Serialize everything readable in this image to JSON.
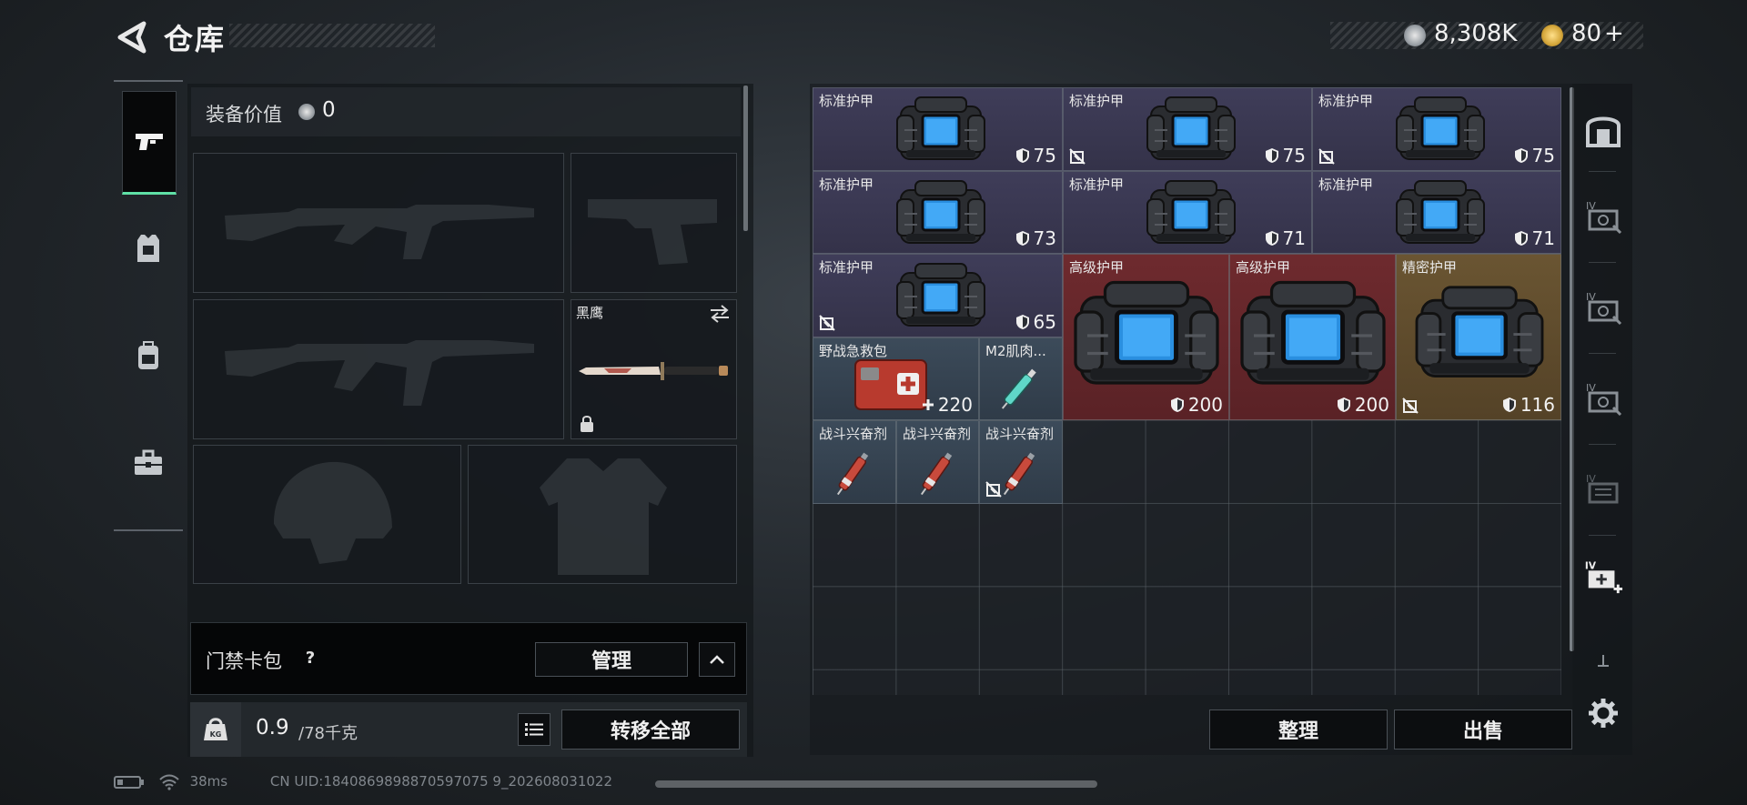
{
  "header": {
    "title": "仓库",
    "currency_1": "8,308K",
    "currency_2": "80",
    "currency_2_plus": "+"
  },
  "equipment": {
    "value_label": "装备价值",
    "value": "0",
    "melee_name": "黑鹰"
  },
  "keycard": {
    "label": "门禁卡包",
    "help": "?",
    "manage_button": "管理"
  },
  "weight": {
    "current": "0.9",
    "max": "/78千克",
    "transfer_all_button": "转移全部",
    "kg_label": "KG"
  },
  "items": [
    {
      "name": "标准护甲",
      "value": "75",
      "type": "armor",
      "rarity": "std",
      "durability_icon": false
    },
    {
      "name": "标准护甲",
      "value": "75",
      "type": "armor",
      "rarity": "std",
      "durability_icon": true
    },
    {
      "name": "标准护甲",
      "value": "75",
      "type": "armor",
      "rarity": "std",
      "durability_icon": true
    },
    {
      "name": "标准护甲",
      "value": "73",
      "type": "armor",
      "rarity": "std",
      "durability_icon": false
    },
    {
      "name": "标准护甲",
      "value": "71",
      "type": "armor",
      "rarity": "std",
      "durability_icon": false
    },
    {
      "name": "标准护甲",
      "value": "71",
      "type": "armor",
      "rarity": "std",
      "durability_icon": false
    },
    {
      "name": "标准护甲",
      "value": "65",
      "type": "armor",
      "rarity": "std",
      "durability_icon": true
    },
    {
      "name": "高级护甲",
      "value": "200",
      "type": "armor",
      "rarity": "adv",
      "durability_icon": false
    },
    {
      "name": "高级护甲",
      "value": "200",
      "type": "armor",
      "rarity": "adv",
      "durability_icon": false
    },
    {
      "name": "精密护甲",
      "value": "116",
      "type": "armor",
      "rarity": "prec",
      "durability_icon": true
    },
    {
      "name": "野战急救包",
      "value": "220",
      "type": "medkit",
      "rarity": "med",
      "durability_icon": false
    },
    {
      "name": "M2肌肉...",
      "value": "",
      "type": "injector",
      "rarity": "med",
      "durability_icon": false
    },
    {
      "name": "战斗兴奋剂",
      "value": "",
      "type": "stim",
      "rarity": "med",
      "durability_icon": false
    },
    {
      "name": "战斗兴奋剂",
      "value": "",
      "type": "stim",
      "rarity": "med",
      "durability_icon": false
    },
    {
      "name": "战斗兴奋剂",
      "value": "",
      "type": "stim",
      "rarity": "med",
      "durability_icon": true
    }
  ],
  "actions": {
    "sort_button": "整理",
    "sell_button": "出售"
  },
  "status": {
    "ping": "38ms",
    "uid": "CN UID:1840869898870597075 9_202608031022"
  },
  "colors": {
    "accent_green": "#5fe0a6",
    "standard_bg": "#3f3d59",
    "advanced_bg": "#6e2a2e",
    "precision_bg": "#6a5532",
    "medical_bg": "#3c4b5a"
  }
}
